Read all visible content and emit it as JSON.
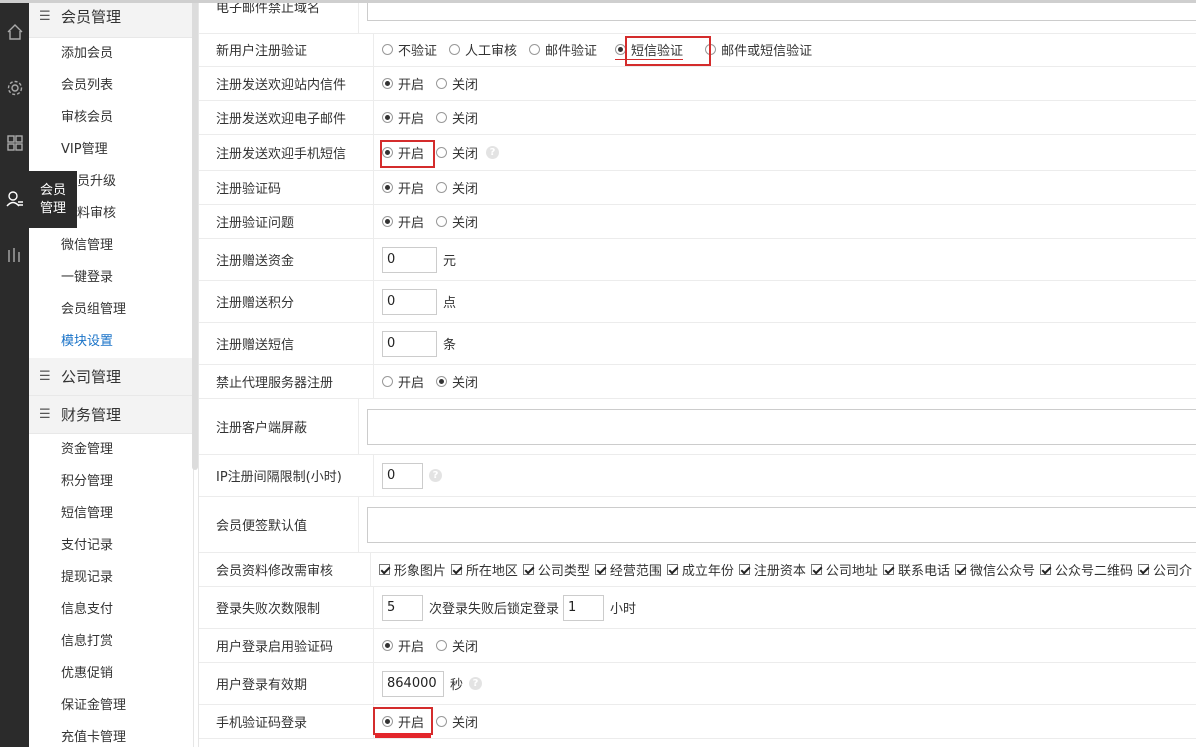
{
  "rail": {
    "tooltip": [
      "会员",
      "管理"
    ]
  },
  "sidebar": {
    "member_head": "会员管理",
    "member_items": [
      "添加会员",
      "会员列表",
      "审核会员",
      "VIP管理",
      "会员升级",
      "资料审核",
      "微信管理",
      "一键登录",
      "会员组管理",
      "模块设置"
    ],
    "member_items_visible": [
      "添加会员",
      "会员列表",
      "审核会员",
      "VIP管理",
      "员升级",
      "料审核",
      "微信管理",
      "一键登录",
      "会员组管理",
      "模块设置"
    ],
    "company_head": "公司管理",
    "finance_head": "财务管理",
    "finance_items": [
      "资金管理",
      "积分管理",
      "短信管理",
      "支付记录",
      "提现记录",
      "信息支付",
      "信息打赏",
      "优惠促销",
      "保证金管理",
      "充值卡管理"
    ]
  },
  "form": {
    "r0": {
      "label": "电子邮件禁止域名"
    },
    "r1": {
      "label": "新用户注册验证",
      "opts": [
        "不验证",
        "人工审核",
        "邮件验证",
        "短信验证",
        "邮件或短信验证"
      ]
    },
    "r2": {
      "label": "注册发送欢迎站内信件",
      "on": "开启",
      "off": "关闭"
    },
    "r3": {
      "label": "注册发送欢迎电子邮件",
      "on": "开启",
      "off": "关闭"
    },
    "r4": {
      "label": "注册发送欢迎手机短信",
      "on": "开启",
      "off": "关闭"
    },
    "r5": {
      "label": "注册验证码",
      "on": "开启",
      "off": "关闭"
    },
    "r6": {
      "label": "注册验证问题",
      "on": "开启",
      "off": "关闭"
    },
    "r7": {
      "label": "注册赠送资金",
      "value": "0",
      "unit": "元"
    },
    "r8": {
      "label": "注册赠送积分",
      "value": "0",
      "unit": "点"
    },
    "r9": {
      "label": "注册赠送短信",
      "value": "0",
      "unit": "条"
    },
    "r10": {
      "label": "禁止代理服务器注册",
      "on": "开启",
      "off": "关闭"
    },
    "r11": {
      "label": "注册客户端屏蔽"
    },
    "r12": {
      "label": "IP注册间隔限制(小时)",
      "value": "0"
    },
    "r13": {
      "label": "会员便签默认值"
    },
    "r14": {
      "label": "会员资料修改需审核",
      "checks": [
        "形象图片",
        "所在地区",
        "公司类型",
        "经营范围",
        "成立年份",
        "注册资本",
        "公司地址",
        "联系电话",
        "微信公众号",
        "公众号二维码",
        "公司介"
      ]
    },
    "r15": {
      "label": "登录失败次数限制",
      "value1": "5",
      "mid": "次登录失败后锁定登录",
      "value2": "1",
      "unit": "小时"
    },
    "r16": {
      "label": "用户登录启用验证码",
      "on": "开启",
      "off": "关闭"
    },
    "r17": {
      "label": "用户登录有效期",
      "value": "864000",
      "unit": "秒"
    },
    "r18": {
      "label": "手机验证码登录",
      "on": "开启",
      "off": "关闭"
    }
  },
  "icons": {
    "help": "?"
  },
  "colors": {
    "accent": "#1a73c8",
    "highlight": "#d42c2c"
  }
}
